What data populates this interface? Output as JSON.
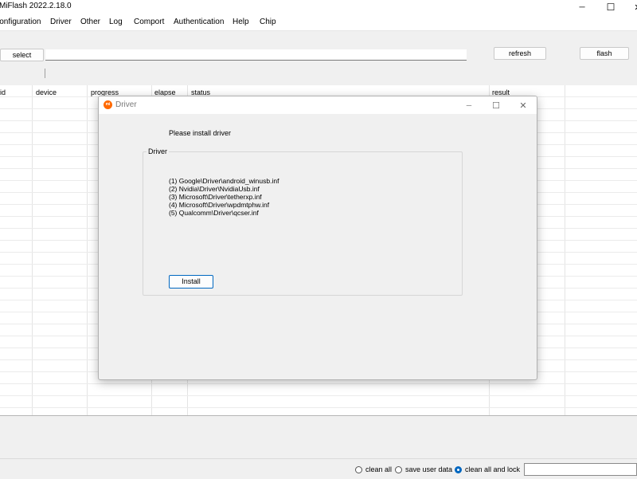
{
  "app": {
    "title": "MiFlash 2022.2.18.0"
  },
  "window_controls": {
    "minimize": "─",
    "maximize": "☐",
    "close": "✕"
  },
  "menu": {
    "items": [
      {
        "label": "Configuration"
      },
      {
        "label": "Driver"
      },
      {
        "label": "Other"
      },
      {
        "label": "Log"
      },
      {
        "label": "Comport"
      },
      {
        "label": "Authentication"
      },
      {
        "label": "Help"
      },
      {
        "label": "Chip"
      }
    ]
  },
  "toolbar": {
    "select_label": "select",
    "path_value": "",
    "refresh_label": "refresh",
    "flash_label": "flash"
  },
  "grid": {
    "columns": [
      {
        "label": "id"
      },
      {
        "label": "device"
      },
      {
        "label": "progress"
      },
      {
        "label": "elapse"
      },
      {
        "label": "status"
      },
      {
        "label": "result"
      }
    ]
  },
  "footer": {
    "options": [
      {
        "label": "clean all",
        "checked": false
      },
      {
        "label": "save user data",
        "checked": false
      },
      {
        "label": "clean all and lock",
        "checked": true
      }
    ],
    "field_value": ""
  },
  "dialog": {
    "logo_text": "mi",
    "title": "Driver",
    "controls": {
      "minimize": "─",
      "maximize": "☐",
      "close": "✕"
    },
    "message": "Please install driver",
    "group_label": "Driver",
    "drivers": [
      "(1) Google\\Driver\\android_winusb.inf",
      "(2) Nvidia\\Driver\\NvidiaUsb.inf",
      "(3) Microsoft\\Driver\\tetherxp.inf",
      "(4) Microsoft\\Driver\\wpdmtphw.inf",
      "(5) Qualcomm\\Driver\\qcser.inf"
    ],
    "install_label": "Install"
  },
  "colors": {
    "accent": "#0067c0",
    "logo": "#ff6900",
    "window_bg": "#f0f0f0"
  }
}
